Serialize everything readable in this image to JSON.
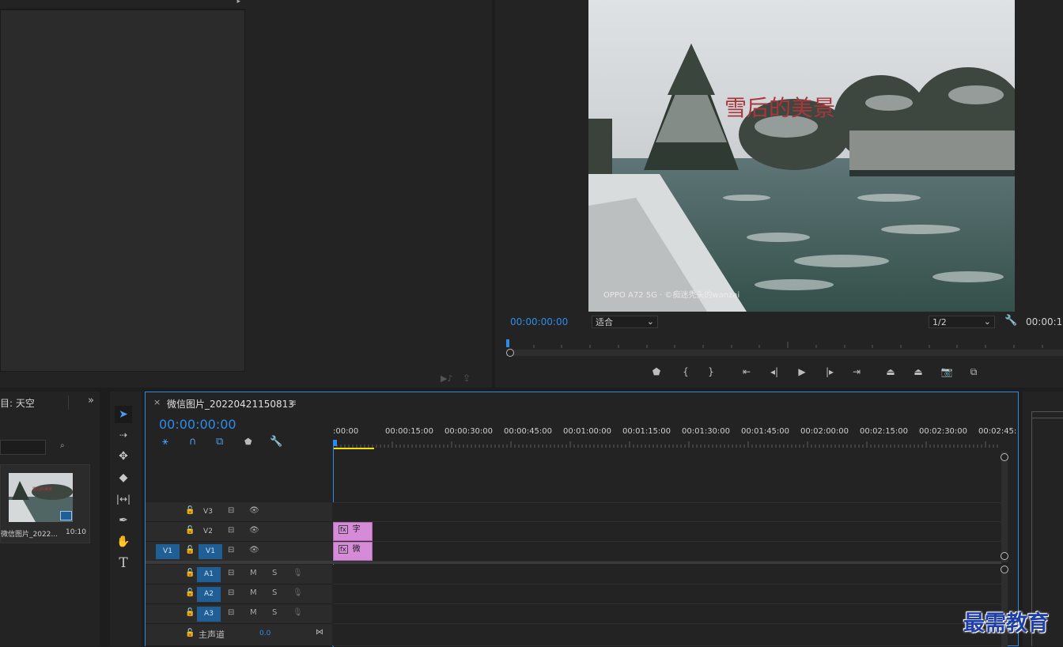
{
  "source_monitor": {
    "icons": [
      "insert-icon",
      "export-frame-icon"
    ]
  },
  "program_monitor": {
    "timecode": "00:00:00:00",
    "fit_select": "适合",
    "resolution_select": "1/2",
    "duration_timecode": "00:00:1",
    "video_title_overlay": "雪后的美景",
    "video_watermark": "OPPO A72 5G · ©痴迷秃头的wanzai",
    "transport_buttons": [
      "marker-icon",
      "mark-in-icon",
      "mark-out-icon",
      "go-to-in-icon",
      "step-back-icon",
      "play-icon",
      "step-forward-icon",
      "go-to-out-icon",
      "lift-icon",
      "extract-icon",
      "camera-icon",
      "compare-icon"
    ]
  },
  "project_panel": {
    "title": "目: 天空",
    "expand": "»",
    "clip_name": "微信图片_2022...",
    "clip_duration": "10:10"
  },
  "timeline": {
    "close": "×",
    "sequence_name": "微信图片_20220421150813",
    "menu": "≡",
    "timecode": "00:00:00:00",
    "ruler_labels": [
      ":00:00",
      "00:00:15:00",
      "00:00:30:00",
      "00:00:45:00",
      "00:01:00:00",
      "00:01:15:00",
      "00:01:30:00",
      "00:01:45:00",
      "00:02:00:00",
      "00:02:15:00",
      "00:02:30:00",
      "00:02:45:"
    ],
    "video_tracks": [
      {
        "source": "",
        "label": "V3",
        "active": false
      },
      {
        "source": "",
        "label": "V2",
        "active": false
      },
      {
        "source": "V1",
        "label": "V1",
        "active": true
      }
    ],
    "audio_tracks": [
      {
        "label": "A1",
        "m": "M",
        "s": "S"
      },
      {
        "label": "A2",
        "m": "M",
        "s": "S"
      },
      {
        "label": "A3",
        "m": "M",
        "s": "S"
      }
    ],
    "master": {
      "label": "主声道",
      "value": "0.0"
    },
    "clips": [
      {
        "track": "V2",
        "name": "字"
      },
      {
        "track": "V1",
        "name": "微"
      }
    ]
  },
  "brand_watermark": "最需教育"
}
